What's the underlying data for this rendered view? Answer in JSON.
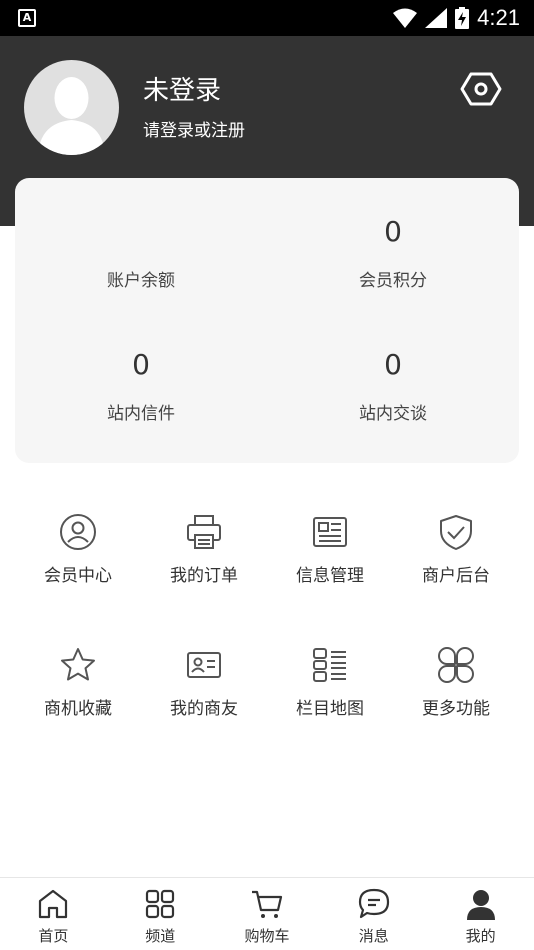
{
  "status_bar": {
    "time": "4:21"
  },
  "profile": {
    "username": "未登录",
    "login_hint": "请登录或注册"
  },
  "stats": [
    {
      "value": "",
      "label": "账户余额"
    },
    {
      "value": "0",
      "label": "会员积分"
    },
    {
      "value": "0",
      "label": "站内信件"
    },
    {
      "value": "0",
      "label": "站内交谈"
    }
  ],
  "functions": [
    {
      "label": "会员中心",
      "icon": "user-circle-icon"
    },
    {
      "label": "我的订单",
      "icon": "printer-icon"
    },
    {
      "label": "信息管理",
      "icon": "news-icon"
    },
    {
      "label": "商户后台",
      "icon": "shield-check-icon"
    },
    {
      "label": "商机收藏",
      "icon": "star-icon"
    },
    {
      "label": "我的商友",
      "icon": "id-card-icon"
    },
    {
      "label": "栏目地图",
      "icon": "list-icon"
    },
    {
      "label": "更多功能",
      "icon": "clover-icon"
    }
  ],
  "bottom_nav": [
    {
      "label": "首页",
      "icon": "home-icon"
    },
    {
      "label": "频道",
      "icon": "grid-icon"
    },
    {
      "label": "购物车",
      "icon": "cart-icon"
    },
    {
      "label": "消息",
      "icon": "message-icon"
    },
    {
      "label": "我的",
      "icon": "person-icon",
      "active": true
    }
  ],
  "colors": {
    "header_bg": "#333333",
    "card_bg": "#f6f6f6",
    "text": "#333333"
  }
}
